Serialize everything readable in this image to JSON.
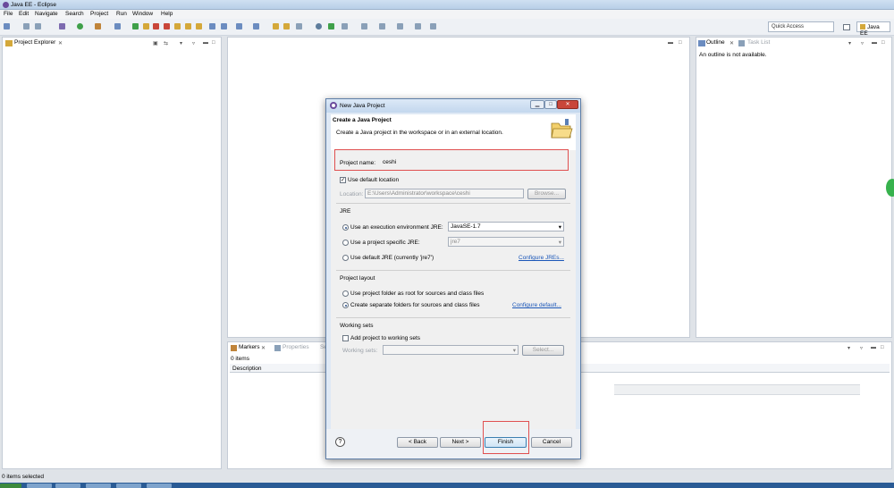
{
  "window": {
    "title": "Java EE - Eclipse"
  },
  "menu": [
    "File",
    "Edit",
    "Navigate",
    "Search",
    "Project",
    "Run",
    "Window",
    "Help"
  ],
  "toolbar": {
    "quick_access": "Quick Access",
    "perspective": "Java EE"
  },
  "project_explorer": {
    "tab": "Project Explorer"
  },
  "outline": {
    "tab_outline": "Outline",
    "tab_tasks": "Task List",
    "message": "An outline is not available."
  },
  "markers": {
    "tab_markers": "Markers",
    "tab_properties": "Properties",
    "tab_more": "Se",
    "count": "0 items",
    "column": "Description"
  },
  "status": {
    "text": "0 items selected"
  },
  "dialog": {
    "title": "New Java Project",
    "header_title": "Create a Java Project",
    "header_desc": "Create a Java project in the workspace or in an external location.",
    "project_name_label": "Project name:",
    "project_name_value": "ceshi",
    "use_default_location": "Use default location",
    "location_label": "Location:",
    "location_value": "E:\\Users\\Administrator\\workspace\\ceshi",
    "browse": "Browse...",
    "jre_group": "JRE",
    "jre_exec_env": "Use an execution environment JRE:",
    "jre_exec_env_value": "JavaSE-1.7",
    "jre_specific": "Use a project specific JRE:",
    "jre_specific_value": "jre7",
    "jre_default": "Use default JRE (currently 'jre7')",
    "configure_jres": "Configure JREs...",
    "layout_group": "Project layout",
    "layout_root": "Use project folder as root for sources and class files",
    "layout_separate": "Create separate folders for sources and class files",
    "configure_default": "Configure default...",
    "working_sets_group": "Working sets",
    "add_to_working_sets": "Add project to working sets",
    "working_sets_label": "Working sets:",
    "select": "Select...",
    "back": "< Back",
    "next": "Next >",
    "finish": "Finish",
    "cancel": "Cancel",
    "help": "?"
  },
  "colors": {
    "highlight": "#e05050",
    "link": "#1a56b8"
  }
}
